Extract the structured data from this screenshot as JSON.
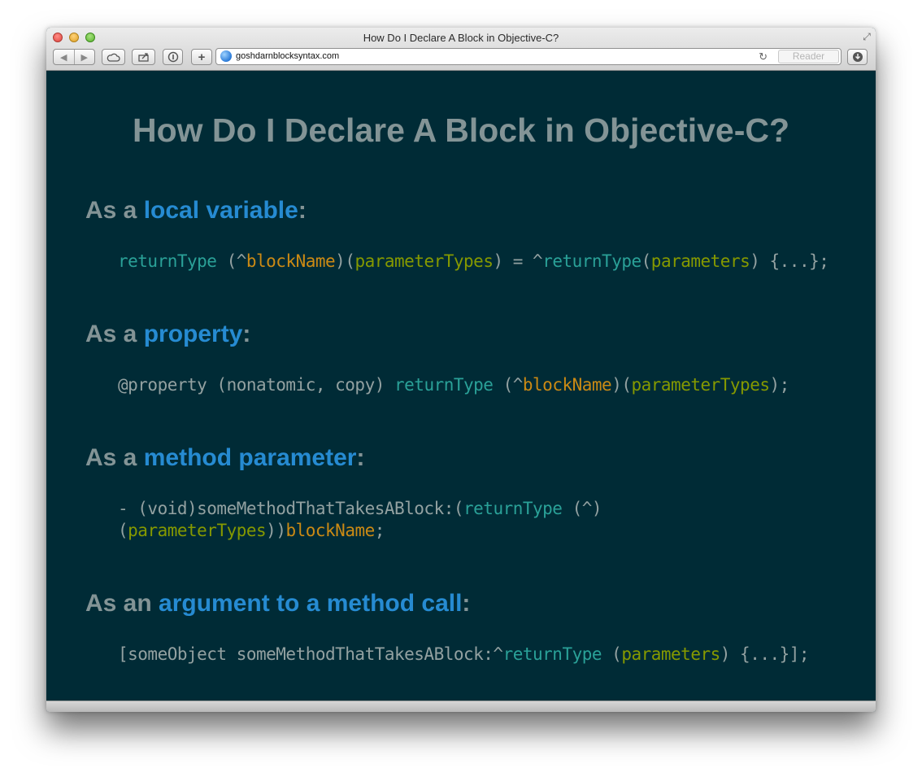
{
  "window": {
    "title": "How Do I Declare A Block in Objective-C?",
    "url": "goshdarnblocksyntax.com",
    "reader_label": "Reader"
  },
  "toolbar": {
    "back_icon": "◀",
    "forward_icon": "▶",
    "icloud_icon": "cloud-icon",
    "share_icon": "share-icon",
    "topsites_icon": "info-icon",
    "add_label": "+",
    "reload_icon": "↻",
    "download_icon": "download-icon"
  },
  "page": {
    "title": "How Do I Declare A Block in Objective-C?",
    "sections": [
      {
        "prefix": "As a ",
        "highlight": "local variable",
        "suffix": ":"
      },
      {
        "prefix": "As a ",
        "highlight": "property",
        "suffix": ":"
      },
      {
        "prefix": "As a ",
        "highlight": "method parameter",
        "suffix": ":"
      },
      {
        "prefix": "As an ",
        "highlight": "argument to a method call",
        "suffix": ":"
      }
    ],
    "code": {
      "local_variable": [
        "returnType",
        " (^",
        "blockName",
        ")(",
        "parameterTypes",
        ") = ^",
        "returnType",
        "(",
        "parameters",
        ") {...};"
      ],
      "property": [
        "@property (nonatomic, copy) ",
        "returnType",
        " (^",
        "blockName",
        ")(",
        "parameterTypes",
        ");"
      ],
      "method_parameter_line1": [
        "- (void)someMethodThatTakesABlock:(",
        "returnType",
        " (^)"
      ],
      "method_parameter_line2": [
        "(",
        "parameterTypes",
        "))",
        "blockName",
        ";"
      ],
      "argument": [
        "[someObject someMethodThatTakesABlock:^",
        "returnType",
        " (",
        "parameters",
        ") {...}];"
      ]
    }
  },
  "colors": {
    "background": "#002b36",
    "text": "#839496",
    "highlight": "#268bd2",
    "type": "#2aa198",
    "name": "#cb8a14",
    "param": "#859900"
  }
}
